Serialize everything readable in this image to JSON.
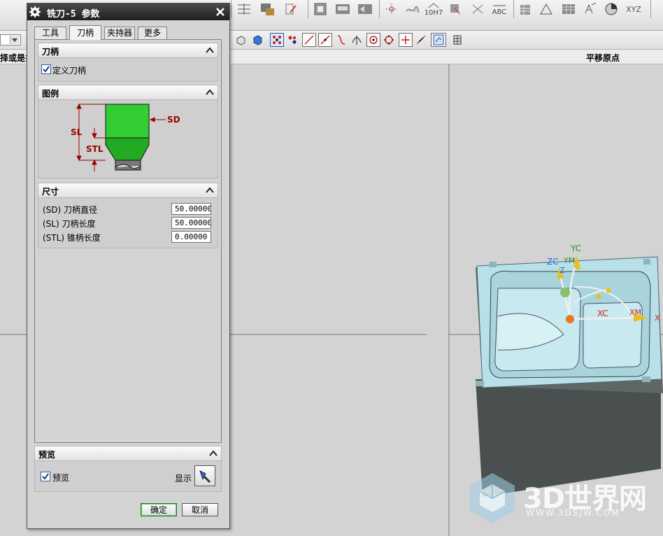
{
  "dialog": {
    "title": "铣刀-5 参数",
    "tabs": [
      {
        "label": "工具"
      },
      {
        "label": "刀柄"
      },
      {
        "label": "夹持器"
      },
      {
        "label": "更多"
      }
    ],
    "active_tab": "刀柄",
    "sections": {
      "shank": {
        "title": "刀柄",
        "checkbox_label": "定义刀柄",
        "checked": true
      },
      "legend": {
        "title": "图例",
        "labels": {
          "sd": "SD",
          "sl": "SL",
          "stl": "STL"
        }
      },
      "dimensions": {
        "title": "尺寸",
        "fields": [
          {
            "label": "(SD) 刀柄直径",
            "value": "50.00000"
          },
          {
            "label": "(SL) 刀柄长度",
            "value": "50.00000"
          },
          {
            "label": "(STL) 锥柄长度",
            "value": "0.00000"
          }
        ]
      },
      "preview": {
        "title": "预览",
        "checkbox_label": "预览",
        "checked": true,
        "show_label": "显示"
      }
    },
    "buttons": {
      "ok": "确定",
      "cancel": "取消"
    }
  },
  "background": {
    "left_header_text": "择或是扌",
    "right_header_text": "平移原点",
    "toolbar_labels": {
      "fit_10h7": "10H7",
      "abc": "ABC",
      "xyz": "XYZ"
    }
  },
  "viewport": {
    "axis_labels": {
      "yc": "YC",
      "zc": "ZC",
      "ym": "YM",
      "zm": "Z",
      "xc": "XC",
      "xm": "XM",
      "x": "X"
    },
    "watermark": {
      "text": "3D世界网",
      "url": "WWW.3DSJW.COM"
    }
  },
  "colors": {
    "dialog_title_bg": "#2b2b2b",
    "shank_green": "#33cc33",
    "dimension_red": "#990000",
    "part_face": "#b8e0e8",
    "part_side": "#4a5050"
  }
}
